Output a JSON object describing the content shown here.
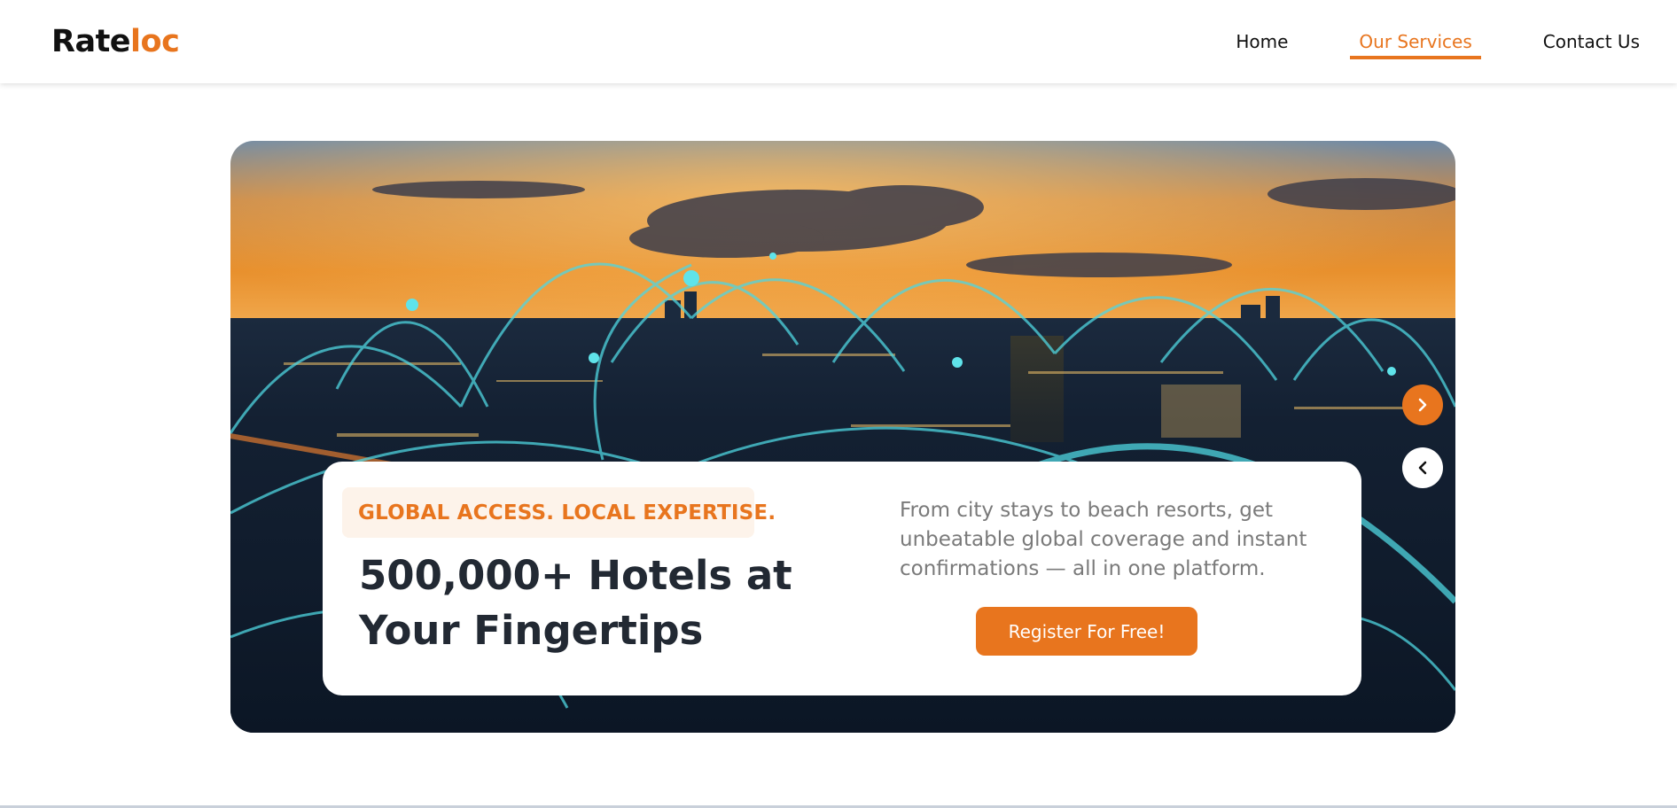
{
  "header": {
    "logo_part1": "Rate",
    "logo_part2": "loc",
    "nav": [
      {
        "label": "Home",
        "active": false
      },
      {
        "label": "Our Services",
        "active": true
      },
      {
        "label": "Contact Us",
        "active": false
      }
    ]
  },
  "hero": {
    "image_icon": "city-network-image",
    "next_icon": "chevron-right-icon",
    "prev_icon": "chevron-left-icon",
    "tagline": "GLOBAL ACCESS. LOCAL EXPERTISE.",
    "headline": "500,000+ Hotels at Your Fingertips",
    "description": "From city stays to beach resorts, get unbeatable global coverage and instant confirmations — all in one platform.",
    "cta_label": "Register For Free!"
  },
  "colors": {
    "accent": "#e8751e",
    "heading": "#222933",
    "body_text": "#7a7a7a",
    "tagline_bg": "#fdf3ea"
  }
}
